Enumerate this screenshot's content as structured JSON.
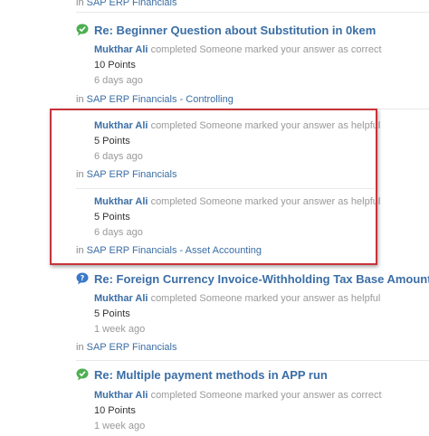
{
  "top_context": {
    "prefix": "in ",
    "link": "SAP ERP Financials"
  },
  "threads": [
    {
      "title": "Re: Beginner Question about Substitution in 0kem",
      "icon": "green-speech-check-icon",
      "entries": [
        {
          "user": "Mukthar Ali",
          "message": "completed Someone marked your answer as correct",
          "points": "10 Points",
          "ago": "6 days ago"
        }
      ],
      "context_prefix": "in ",
      "context_link": "SAP ERP Financials - Controlling"
    },
    {
      "title": "",
      "icon": "",
      "entries": [
        {
          "user": "Mukthar Ali",
          "message": "completed Someone marked your answer as helpful",
          "points": "5 Points",
          "ago": "6 days ago"
        }
      ],
      "context_prefix": "in ",
      "context_link": "SAP ERP Financials"
    },
    {
      "title": "",
      "icon": "",
      "entries": [
        {
          "user": "Mukthar Ali",
          "message": "completed Someone marked your answer as helpful",
          "points": "5 Points",
          "ago": "6 days ago"
        }
      ],
      "context_prefix": "in ",
      "context_link": "SAP ERP Financials - Asset Accounting"
    },
    {
      "title": "Re: Foreign Currency Invoice-Withholding Tax Base Amount",
      "icon": "blue-speech-question-icon",
      "entries": [
        {
          "user": "Mukthar Ali",
          "message": "completed Someone marked your answer as helpful",
          "points": "5 Points",
          "ago": "1 week ago"
        }
      ],
      "context_prefix": "in ",
      "context_link": "SAP ERP Financials"
    },
    {
      "title": "Re: Multiple payment methods in APP run",
      "icon": "green-speech-check-icon",
      "entries": [
        {
          "user": "Mukthar Ali",
          "message": "completed Someone marked your answer as correct",
          "points": "10 Points",
          "ago": "1 week ago"
        }
      ],
      "context_prefix": "",
      "context_link": ""
    }
  ],
  "colors": {
    "link": "#3b6ea5",
    "muted": "#999999",
    "highlight_border": "#c8333a",
    "icon_green": "#4caf50",
    "icon_blue": "#3a78c9"
  }
}
